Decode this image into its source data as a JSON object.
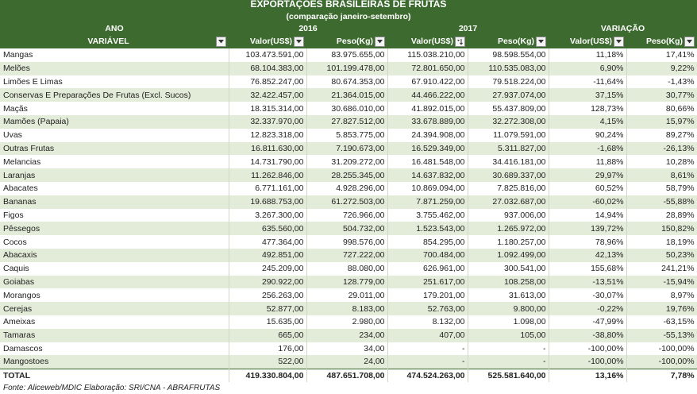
{
  "title": "EXPORTAÇÕES BRASILEIRAS DE FRUTAS",
  "subtitle": "(comparação janeiro-setembro)",
  "header": {
    "ano_label": "ANO",
    "year_2016": "2016",
    "year_2017": "2017",
    "variacao": "VARIAÇÃO",
    "variavel": "VARIÁVEL",
    "valor": "Valor(US$)",
    "peso": "Peso(Kg)"
  },
  "rows": [
    {
      "name": "Mangas",
      "v16": "103.473.591,00",
      "p16": "83.975.655,00",
      "v17": "115.038.210,00",
      "p17": "98.598.554,00",
      "vv": "11,18%",
      "vp": "17,41%"
    },
    {
      "name": "Melões",
      "v16": "68.104.383,00",
      "p16": "101.199.478,00",
      "v17": "72.801.650,00",
      "p17": "110.535.083,00",
      "vv": "6,90%",
      "vp": "9,22%"
    },
    {
      "name": "Limões E Limas",
      "v16": "76.852.247,00",
      "p16": "80.674.353,00",
      "v17": "67.910.422,00",
      "p17": "79.518.224,00",
      "vv": "-11,64%",
      "vp": "-1,43%"
    },
    {
      "name": "Conservas E Preparações De Frutas (Excl. Sucos)",
      "v16": "32.422.457,00",
      "p16": "21.364.015,00",
      "v17": "44.466.222,00",
      "p17": "27.937.074,00",
      "vv": "37,15%",
      "vp": "30,77%"
    },
    {
      "name": "Maçãs",
      "v16": "18.315.314,00",
      "p16": "30.686.010,00",
      "v17": "41.892.015,00",
      "p17": "55.437.809,00",
      "vv": "128,73%",
      "vp": "80,66%"
    },
    {
      "name": "Mamões (Papaia)",
      "v16": "32.337.970,00",
      "p16": "27.827.512,00",
      "v17": "33.678.889,00",
      "p17": "32.272.308,00",
      "vv": "4,15%",
      "vp": "15,97%"
    },
    {
      "name": "Uvas",
      "v16": "12.823.318,00",
      "p16": "5.853.775,00",
      "v17": "24.394.908,00",
      "p17": "11.079.591,00",
      "vv": "90,24%",
      "vp": "89,27%"
    },
    {
      "name": "Outras Frutas",
      "v16": "16.811.630,00",
      "p16": "7.190.673,00",
      "v17": "16.529.349,00",
      "p17": "5.311.827,00",
      "vv": "-1,68%",
      "vp": "-26,13%"
    },
    {
      "name": "Melancias",
      "v16": "14.731.790,00",
      "p16": "31.209.272,00",
      "v17": "16.481.548,00",
      "p17": "34.416.181,00",
      "vv": "11,88%",
      "vp": "10,28%"
    },
    {
      "name": "Laranjas",
      "v16": "11.262.846,00",
      "p16": "28.255.345,00",
      "v17": "14.637.832,00",
      "p17": "30.689.337,00",
      "vv": "29,97%",
      "vp": "8,61%"
    },
    {
      "name": "Abacates",
      "v16": "6.771.161,00",
      "p16": "4.928.296,00",
      "v17": "10.869.094,00",
      "p17": "7.825.816,00",
      "vv": "60,52%",
      "vp": "58,79%"
    },
    {
      "name": "Bananas",
      "v16": "19.688.753,00",
      "p16": "61.272.503,00",
      "v17": "7.871.259,00",
      "p17": "27.032.687,00",
      "vv": "-60,02%",
      "vp": "-55,88%"
    },
    {
      "name": "Figos",
      "v16": "3.267.300,00",
      "p16": "726.966,00",
      "v17": "3.755.462,00",
      "p17": "937.006,00",
      "vv": "14,94%",
      "vp": "28,89%"
    },
    {
      "name": "Pêssegos",
      "v16": "635.560,00",
      "p16": "504.732,00",
      "v17": "1.523.543,00",
      "p17": "1.265.972,00",
      "vv": "139,72%",
      "vp": "150,82%"
    },
    {
      "name": "Cocos",
      "v16": "477.364,00",
      "p16": "998.576,00",
      "v17": "854.295,00",
      "p17": "1.180.257,00",
      "vv": "78,96%",
      "vp": "18,19%"
    },
    {
      "name": "Abacaxis",
      "v16": "492.851,00",
      "p16": "727.222,00",
      "v17": "700.484,00",
      "p17": "1.092.499,00",
      "vv": "42,13%",
      "vp": "50,23%"
    },
    {
      "name": "Caquis",
      "v16": "245.209,00",
      "p16": "88.080,00",
      "v17": "626.961,00",
      "p17": "300.541,00",
      "vv": "155,68%",
      "vp": "241,21%"
    },
    {
      "name": "Goiabas",
      "v16": "290.922,00",
      "p16": "128.779,00",
      "v17": "251.617,00",
      "p17": "108.258,00",
      "vv": "-13,51%",
      "vp": "-15,94%"
    },
    {
      "name": "Morangos",
      "v16": "256.263,00",
      "p16": "29.011,00",
      "v17": "179.201,00",
      "p17": "31.613,00",
      "vv": "-30,07%",
      "vp": "8,97%"
    },
    {
      "name": "Cerejas",
      "v16": "52.877,00",
      "p16": "8.183,00",
      "v17": "52.763,00",
      "p17": "9.800,00",
      "vv": "-0,22%",
      "vp": "19,76%"
    },
    {
      "name": "Ameixas",
      "v16": "15.635,00",
      "p16": "2.980,00",
      "v17": "8.132,00",
      "p17": "1.098,00",
      "vv": "-47,99%",
      "vp": "-63,15%"
    },
    {
      "name": "Tamaras",
      "v16": "665,00",
      "p16": "234,00",
      "v17": "407,00",
      "p17": "105,00",
      "vv": "-38,80%",
      "vp": "-55,13%"
    },
    {
      "name": "Damascos",
      "v16": "176,00",
      "p16": "34,00",
      "v17": "-",
      "p17": "-",
      "vv": "-100,00%",
      "vp": "-100,00%"
    },
    {
      "name": "Mangostoes",
      "v16": "522,00",
      "p16": "24,00",
      "v17": "-",
      "p17": "-",
      "vv": "-100,00%",
      "vp": "-100,00%"
    }
  ],
  "total": {
    "name": "TOTAL",
    "v16": "419.330.804,00",
    "p16": "487.651.708,00",
    "v17": "474.524.263,00",
    "p17": "525.581.640,00",
    "vv": "13,16%",
    "vp": "7,78%"
  },
  "footer": "Fonte: Aliceweb/MDIC Elaboração: SRI/CNA - ABRAFRUTAS",
  "icons": {
    "filter": "filter-dropdown-icon",
    "sort": "sort-descending-filter-icon"
  },
  "colors": {
    "header_bg": "#3d6b2f",
    "band": "#e3ecd9"
  }
}
